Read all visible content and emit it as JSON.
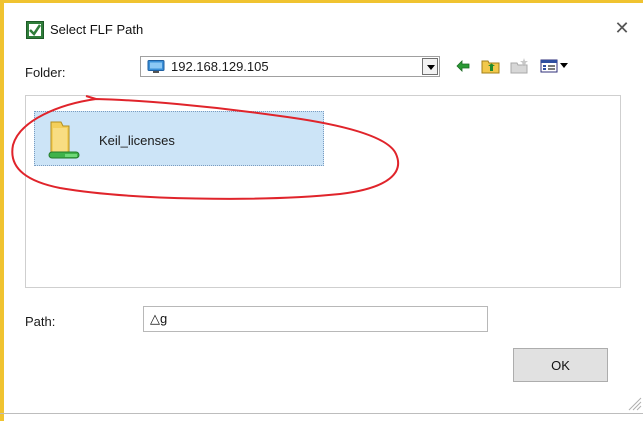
{
  "window": {
    "title": "Select FLF Path",
    "close_icon": "close-icon"
  },
  "folder": {
    "label": "Folder:",
    "selected": "192.168.129.105",
    "icon": "network-computer-icon"
  },
  "toolbar": {
    "back_icon": "back-arrow-icon",
    "up_icon": "up-folder-icon",
    "new_folder_icon": "new-folder-icon",
    "view_menu_icon": "view-menu-icon"
  },
  "files": [
    {
      "name": "Keil_licenses",
      "icon": "network-folder-icon",
      "selected": true
    }
  ],
  "path": {
    "label": "Path:",
    "value": "△g"
  },
  "buttons": {
    "ok": "OK"
  },
  "colors": {
    "window_border": "#f0c330",
    "selection": "#cce4f7",
    "annotation": "#e0242b"
  }
}
